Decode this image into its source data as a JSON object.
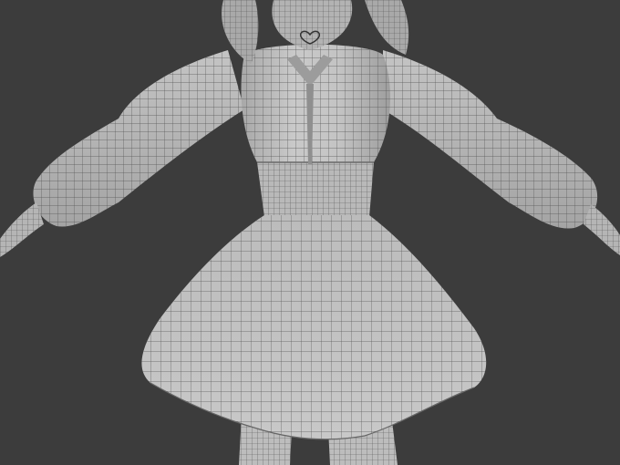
{
  "scene": {
    "background_color": "#3c3c3c",
    "mesh_fill_color": "#bdbdbd",
    "mesh_shade_color": "#9a9a9a",
    "wire_color": "#4a4a4a",
    "subject": "wireframe-3d-character-model-dress"
  }
}
